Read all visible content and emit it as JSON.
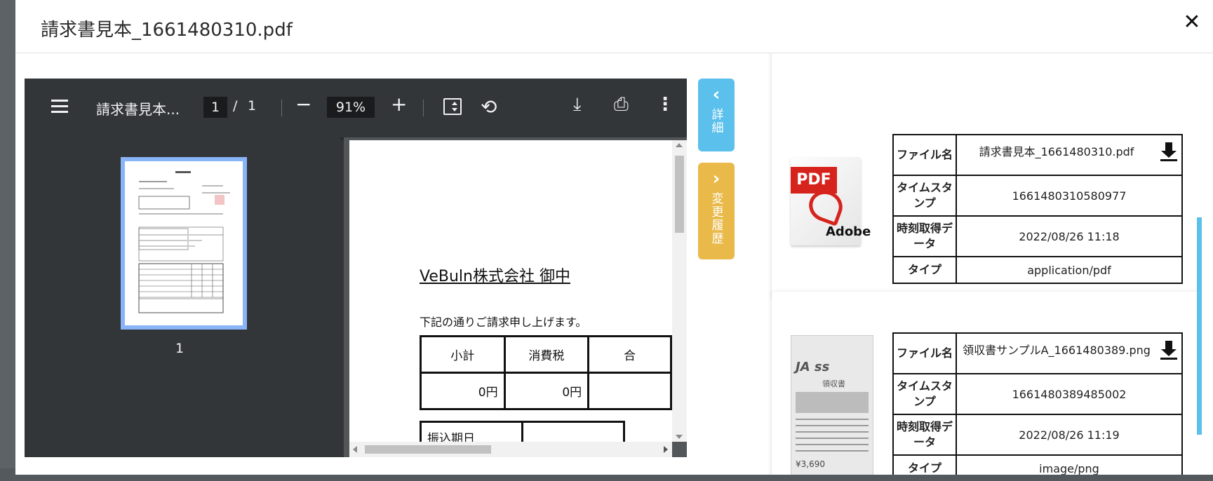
{
  "modal": {
    "title": "請求書見本_1661480310.pdf",
    "close_label": "✕"
  },
  "viewer": {
    "doc_name": "請求書見本...",
    "page_current": "1",
    "page_separator": "/",
    "page_total": "1",
    "zoom": "91%",
    "zoom_out": "−",
    "zoom_in": "+",
    "thumbnail_page_number": "1",
    "icons": {
      "menu": "menu-icon",
      "fit": "fit-page-icon",
      "rotate": "rotate-icon",
      "download": "download-icon",
      "print": "print-icon",
      "more": "more-vert-icon"
    },
    "rotate_glyph": "⟲",
    "download_glyph": "⤓",
    "print_glyph": "⎙",
    "more_glyph": "⋮"
  },
  "document": {
    "company": "VeBuln株式会社 御中",
    "intro": "下記の通りご請求申し上げます。",
    "table_headers": [
      "小計",
      "消費税",
      "合"
    ],
    "table_values": [
      "0円",
      "0円",
      ""
    ],
    "due_label": "振込期日"
  },
  "side_tabs": {
    "detail": {
      "chevron": "‹",
      "label": "詳細",
      "color": "#5bc0eb"
    },
    "history": {
      "chevron": "›",
      "label": "変更履歴",
      "color": "#e9b949"
    }
  },
  "files": [
    {
      "icon": "pdf-file-icon",
      "icon_text": {
        "badge": "PDF",
        "brand": "Adobe"
      },
      "labels": {
        "filename": "ファイル名",
        "timestamp": "タイムスタンプ",
        "acquired": "時刻取得データ",
        "type": "タイプ"
      },
      "filename": "請求書見本_1661480310.pdf",
      "timestamp": "1661480310580977",
      "acquired": "2022/08/26 11:18",
      "type": "application/pdf"
    },
    {
      "icon": "png-receipt-thumbnail",
      "icon_text": {
        "logo": "JA ss",
        "title": "領収書",
        "yen": "¥3,690"
      },
      "labels": {
        "filename": "ファイル名",
        "timestamp": "タイムスタンプ",
        "acquired": "時刻取得データ",
        "type": "タイプ"
      },
      "filename": "領収書サンプルA_1661480389.png",
      "timestamp": "1661480389485002",
      "acquired": "2022/08/26 11:19",
      "type": "image/png"
    }
  ]
}
